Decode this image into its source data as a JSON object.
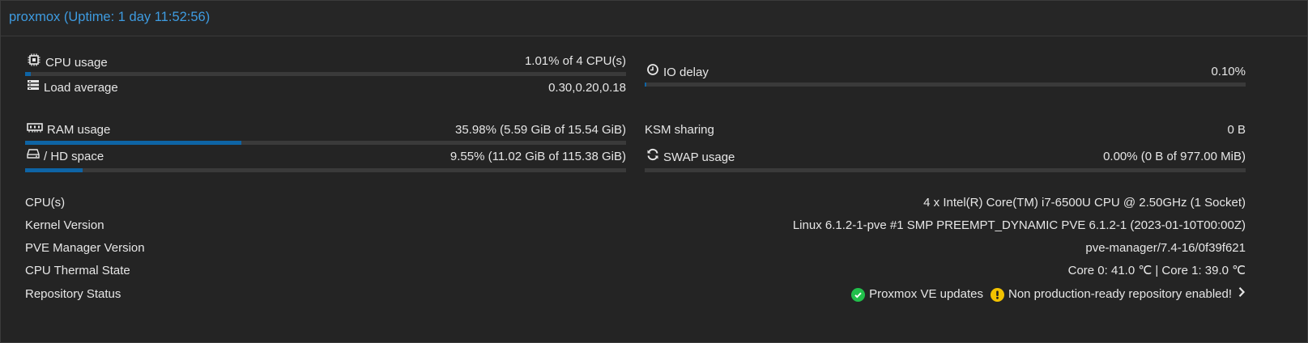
{
  "header": {
    "title": "proxmox (Uptime: 1 day 11:52:56)"
  },
  "colors": {
    "accent": "#3e9be0",
    "bar_fill": "#0e64a5",
    "bar_track": "#3a3a3a",
    "ok": "#21bf4b",
    "warning": "#f2c200"
  },
  "metrics": {
    "cpu": {
      "label": "CPU usage",
      "value": "1.01% of 4 CPU(s)",
      "usage_fraction": 0.0101,
      "icon": "cpu-icon"
    },
    "load": {
      "label": "Load average",
      "value": "0.30,0.20,0.18",
      "icon": "tasks-icon"
    },
    "io_delay": {
      "label": "IO delay",
      "value": "0.10%",
      "usage_fraction": 0.001,
      "icon": "clock-icon"
    },
    "ram": {
      "label": "RAM usage",
      "value": "35.98% (5.59 GiB of 15.54 GiB)",
      "usage_fraction": 0.3598,
      "icon": "memory-icon"
    },
    "ksm": {
      "label": "KSM sharing",
      "value": "0 B"
    },
    "hd": {
      "label": "/ HD space",
      "value": "9.55% (11.02 GiB of 115.38 GiB)",
      "usage_fraction": 0.0955,
      "icon": "hdd-icon"
    },
    "swap": {
      "label": "SWAP usage",
      "value": "0.00% (0 B of 977.00 MiB)",
      "usage_fraction": 0,
      "icon": "refresh-icon"
    }
  },
  "info": {
    "cpus": {
      "label": "CPU(s)",
      "value": "4 x Intel(R) Core(TM) i7-6500U CPU @ 2.50GHz (1 Socket)"
    },
    "kernel": {
      "label": "Kernel Version",
      "value": "Linux 6.1.2-1-pve #1 SMP PREEMPT_DYNAMIC PVE 6.1.2-1 (2023-01-10T00:00Z)"
    },
    "pve_manager": {
      "label": "PVE Manager Version",
      "value": "pve-manager/7.4-16/0f39f621"
    },
    "thermal": {
      "label": "CPU Thermal State",
      "value": "Core 0: 41.0 ℃ | Core 1: 39.0 ℃"
    },
    "repository": {
      "label": "Repository Status",
      "updates_text": "Proxmox VE updates",
      "updates_icon": "check-circle-icon",
      "warning_text": "Non production-ready repository enabled!",
      "warning_icon": "exclamation-circle-icon",
      "more_icon": "chevron-right-icon"
    }
  }
}
